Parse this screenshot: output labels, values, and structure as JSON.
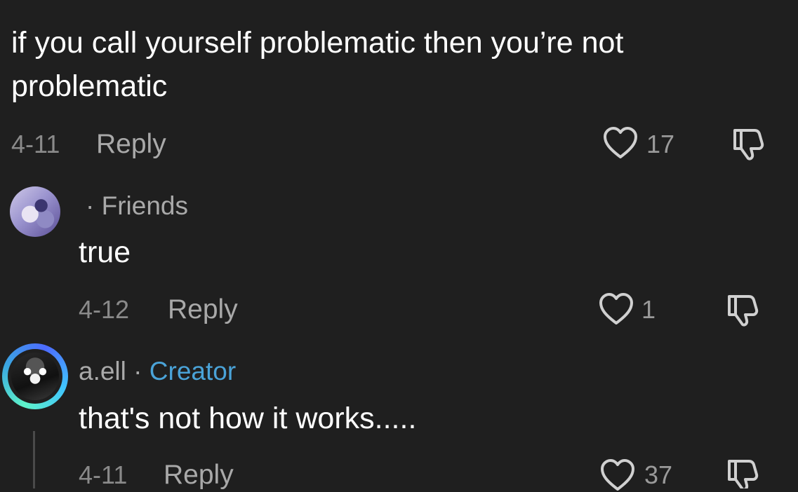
{
  "top_comment": {
    "line1": "if you call yourself problematic then you’re not",
    "line2": "problematic",
    "date": "4-11",
    "reply_label": "Reply",
    "likes": "17",
    "like_icon": "heart-icon",
    "dislike_icon": "thumbs-down-icon"
  },
  "reply_friend": {
    "username_suffix": "· Friends",
    "text": "true",
    "date": "4-12",
    "reply_label": "Reply",
    "likes": "1"
  },
  "reply_creator": {
    "username": "a.ell",
    "separator": "·",
    "badge": "Creator",
    "text": "that's not how it works.....",
    "date": "4-11",
    "reply_label": "Reply",
    "likes": "37"
  },
  "colors": {
    "background": "#1f1f1f",
    "creator_badge": "#4aa3d8",
    "text": "#ffffff",
    "muted": "#a9a9a9"
  }
}
